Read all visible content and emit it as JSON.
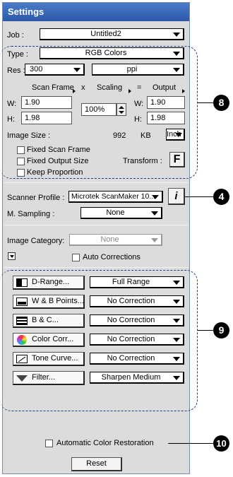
{
  "window": {
    "title": "Settings"
  },
  "job": {
    "label": "Job :",
    "value": "Untitled2"
  },
  "type": {
    "label": "Type :",
    "value": "RGB Colors"
  },
  "res": {
    "label": "Res :",
    "value": "300",
    "unit": "ppi"
  },
  "scan_header": {
    "scan_frame": "Scan Frame",
    "x": "x",
    "scaling": "Scaling",
    "eq": "=",
    "output": "Output"
  },
  "scan": {
    "w_label": "W:",
    "w_value": "1.90",
    "h_label": "H:",
    "h_value": "1.98"
  },
  "scaling": {
    "value": "100%"
  },
  "output": {
    "w_label": "W:",
    "w_value": "1.90",
    "h_label": "H:",
    "h_value": "1.98"
  },
  "image_size": {
    "label": "Image Size :",
    "value": "992",
    "unit": "KB",
    "unit_select": "Inch"
  },
  "options": {
    "fixed_scan_frame": "Fixed Scan Frame",
    "fixed_output_size": "Fixed Output Size",
    "keep_proportion": "Keep Proportion"
  },
  "transform": {
    "label": "Transform :",
    "button": "F"
  },
  "scanner_profile": {
    "label": "Scanner Profile :",
    "value": "Microtek ScanMaker 10..."
  },
  "info_button": {
    "text": "i"
  },
  "m_sampling": {
    "label": "M. Sampling :",
    "value": "None"
  },
  "image_category": {
    "label": "Image Category:",
    "value": "None"
  },
  "auto_corrections": {
    "label": "Auto Corrections"
  },
  "tools": [
    {
      "button": "D-Range...",
      "value": "Full Range",
      "icon": "drange-icon"
    },
    {
      "button": "W & B Points...",
      "value": "No Correction",
      "icon": "wb-points-icon"
    },
    {
      "button": "B & C...",
      "value": "No Correction",
      "icon": "bc-icon"
    },
    {
      "button": "Color Corr...",
      "value": "No Correction",
      "icon": "color-wheel-icon"
    },
    {
      "button": "Tone Curve...",
      "value": "No Correction",
      "icon": "tone-curve-icon"
    },
    {
      "button": "Filter...",
      "value": "Sharpen Medium",
      "icon": "filter-icon"
    }
  ],
  "auto_color_restoration": {
    "label": "Automatic Color Restoration"
  },
  "reset": {
    "label": "Reset"
  },
  "callouts": {
    "c8": "8",
    "c4": "4",
    "c9": "9",
    "c10": "10"
  }
}
